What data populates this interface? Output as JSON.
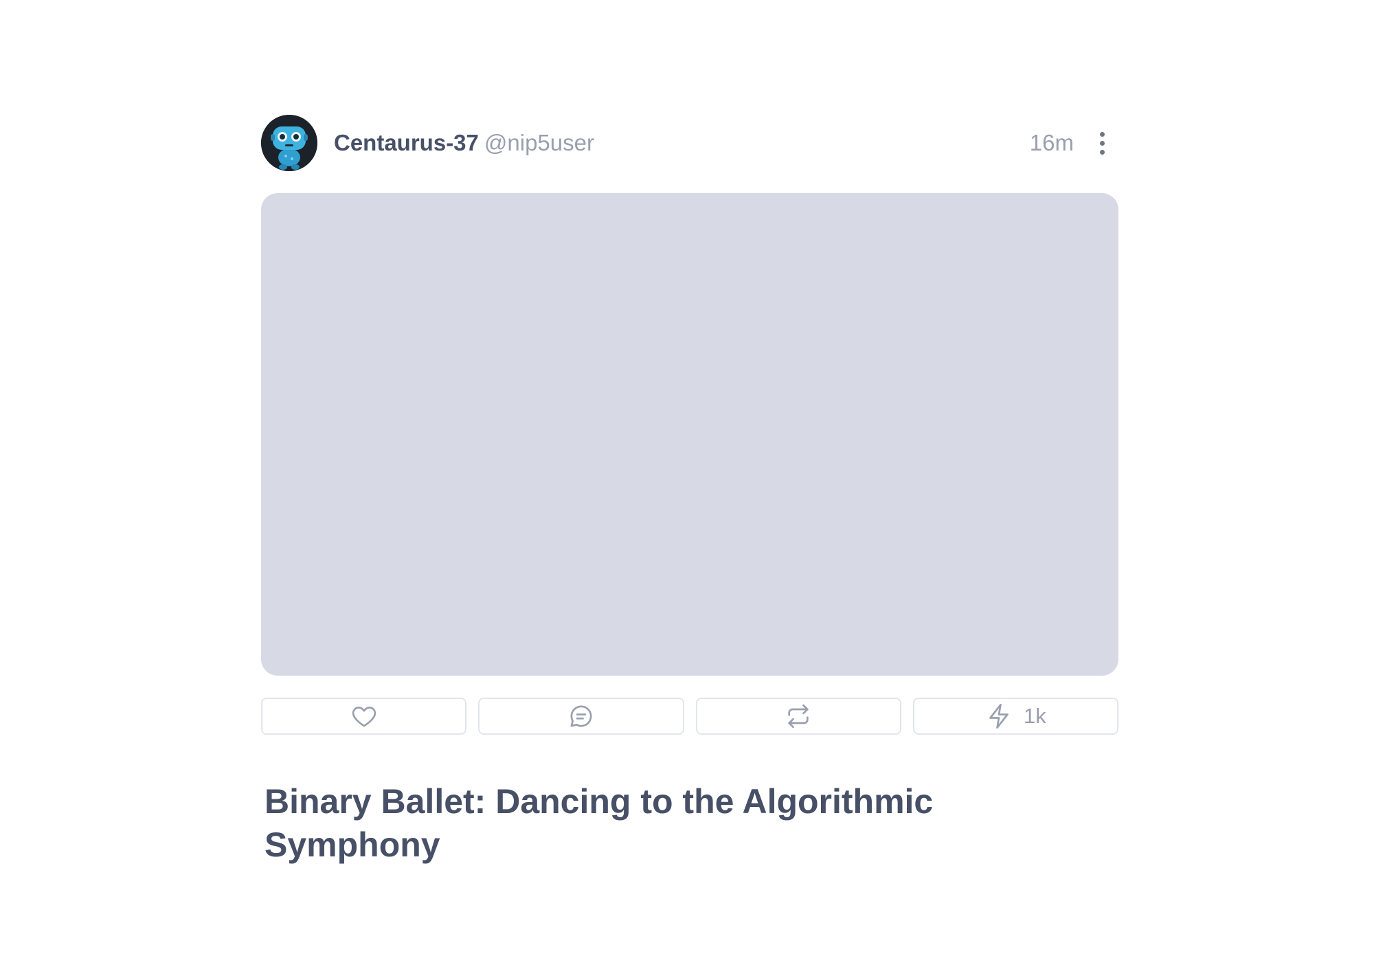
{
  "post": {
    "author": {
      "display_name": "Centaurus-37",
      "handle": "@nip5user",
      "avatar_icon": "robot-avatar"
    },
    "time": "16m",
    "media": {
      "background": "#d7d9e5"
    },
    "actions": {
      "like_icon": "heart-icon",
      "reply_icon": "message-icon",
      "repost_icon": "repost-icon",
      "zap_icon": "lightning-icon",
      "zap_count": "1k"
    },
    "title": "Binary Ballet: Dancing to the Algorithmic Symphony"
  },
  "colors": {
    "text_primary": "#475066",
    "text_muted": "#9a9fae",
    "border": "#e3e5ee",
    "icon": "#9a9fae"
  }
}
